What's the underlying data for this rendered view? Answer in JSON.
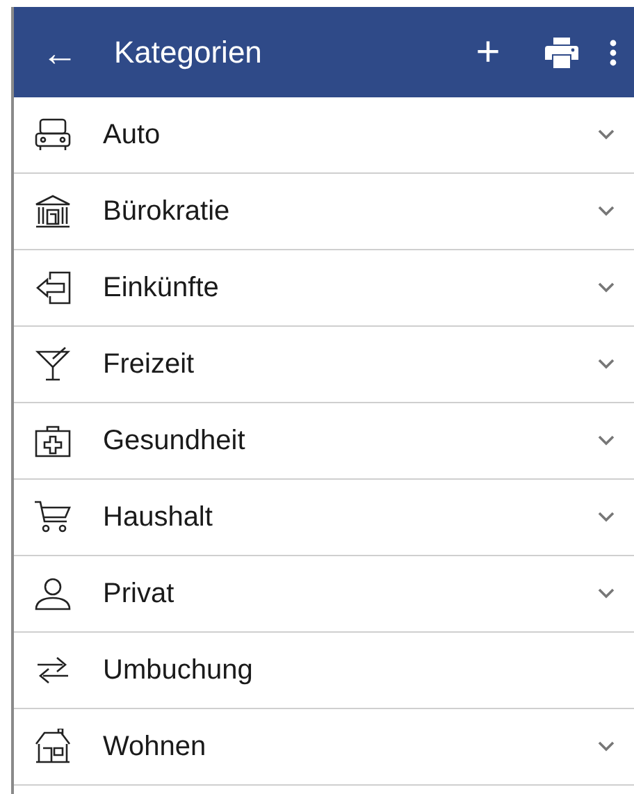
{
  "app_bar": {
    "back_icon": "←",
    "title": "Kategorien",
    "add": "+"
  },
  "categories": [
    {
      "label": "Auto",
      "expandable": true
    },
    {
      "label": "Bürokratie",
      "expandable": true
    },
    {
      "label": "Einkünfte",
      "expandable": true
    },
    {
      "label": "Freizeit",
      "expandable": true
    },
    {
      "label": "Gesundheit",
      "expandable": true
    },
    {
      "label": "Haushalt",
      "expandable": true
    },
    {
      "label": "Privat",
      "expandable": true
    },
    {
      "label": "Umbuchung",
      "expandable": false
    },
    {
      "label": "Wohnen",
      "expandable": true
    }
  ]
}
